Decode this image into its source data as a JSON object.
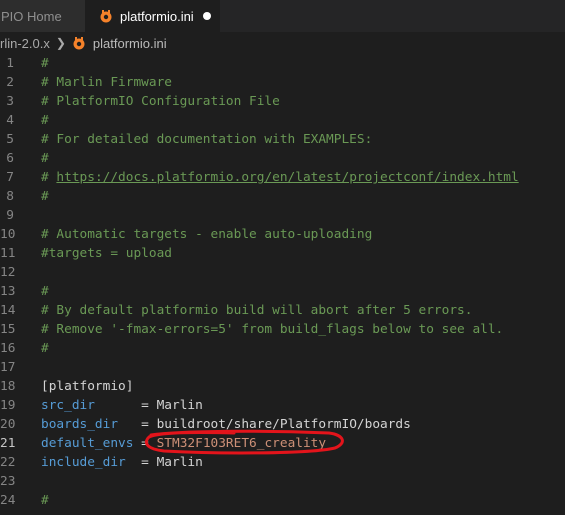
{
  "tabs": [
    {
      "label": "PIO Home",
      "active": false
    },
    {
      "label": "platformio.ini",
      "active": true,
      "unsaved": true
    }
  ],
  "breadcrumbs": {
    "folder": "rlin-2.0.x",
    "file": "platformio.ini"
  },
  "colors": {
    "background": "#1e1e1e",
    "comment": "#6a9955",
    "key": "#569cd6",
    "platformio_orange": "#f5822a",
    "annotation_red": "#e3141b"
  },
  "editor": {
    "current_line": "21",
    "lines": [
      {
        "num": "1",
        "text": "#",
        "kind": "comment"
      },
      {
        "num": "2",
        "text": "# Marlin Firmware",
        "kind": "comment"
      },
      {
        "num": "3",
        "text": "# PlatformIO Configuration File",
        "kind": "comment"
      },
      {
        "num": "4",
        "text": "#",
        "kind": "comment"
      },
      {
        "num": "5",
        "text": "# For detailed documentation with EXAMPLES:",
        "kind": "comment"
      },
      {
        "num": "6",
        "text": "#",
        "kind": "comment"
      },
      {
        "num": "7",
        "prefix": "# ",
        "link": "https://docs.platformio.org/en/latest/projectconf/index.html",
        "kind": "link"
      },
      {
        "num": "8",
        "text": "#",
        "kind": "comment"
      },
      {
        "num": "9",
        "text": "",
        "kind": "blank"
      },
      {
        "num": "10",
        "text": "# Automatic targets - enable auto-uploading",
        "kind": "comment"
      },
      {
        "num": "11",
        "text": "#targets = upload",
        "kind": "comment"
      },
      {
        "num": "12",
        "text": "",
        "kind": "blank"
      },
      {
        "num": "13",
        "text": "#",
        "kind": "comment"
      },
      {
        "num": "14",
        "text": "# By default platformio build will abort after 5 errors.",
        "kind": "comment"
      },
      {
        "num": "15",
        "text": "# Remove '-fmax-errors=5' from build_flags below to see all.",
        "kind": "comment"
      },
      {
        "num": "16",
        "text": "#",
        "kind": "comment"
      },
      {
        "num": "17",
        "text": "",
        "kind": "blank"
      },
      {
        "num": "18",
        "text": "[platformio]",
        "kind": "section"
      },
      {
        "num": "19",
        "key": "src_dir",
        "pad": "      ",
        "value": "Marlin",
        "kind": "kv"
      },
      {
        "num": "20",
        "key": "boards_dir",
        "pad": "   ",
        "value": "buildroot/share/PlatformIO/boards",
        "kind": "kv"
      },
      {
        "num": "21",
        "key": "default_envs",
        "pad": " ",
        "value": "STM32F103RET6_creality",
        "kind": "kv"
      },
      {
        "num": "22",
        "key": "include_dir",
        "pad": "  ",
        "value": "Marlin",
        "kind": "kv"
      },
      {
        "num": "23",
        "text": "",
        "kind": "blank"
      },
      {
        "num": "24",
        "text": "#",
        "kind": "comment"
      }
    ]
  }
}
